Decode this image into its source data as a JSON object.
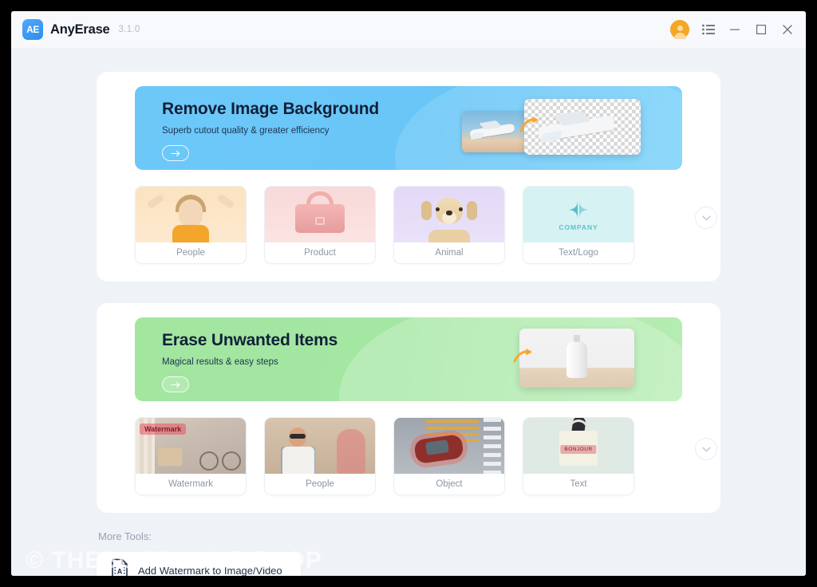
{
  "titlebar": {
    "logo_text": "AE",
    "app_name": "AnyErase",
    "version": "3.1.0",
    "account_icon": "user-avatar-icon",
    "menu_icon": "list-menu-icon",
    "minimize_label": "—",
    "maximize_label": "□",
    "close_label": "✕"
  },
  "sections": [
    {
      "id": "remove-background",
      "hero": {
        "title": "Remove Image Background",
        "subtitle": "Superb cutout quality & greater efficiency",
        "cta_icon": "arrow-right-icon",
        "accent": "#69c6f7"
      },
      "expand_icon": "chevron-down-icon",
      "cards": [
        {
          "label": "People",
          "thumb": "girl-photo"
        },
        {
          "label": "Product",
          "thumb": "pink-handbag-photo"
        },
        {
          "label": "Animal",
          "thumb": "golden-retriever-photo"
        },
        {
          "label": "Text/Logo",
          "thumb": "company-logo-graphic",
          "logo_caption": "COMPANY"
        }
      ]
    },
    {
      "id": "erase-items",
      "hero": {
        "title": "Erase Unwanted Items",
        "subtitle": "Magical results & easy steps",
        "cta_icon": "arrow-right-icon",
        "accent": "#a2e6a0"
      },
      "expand_icon": "chevron-down-icon",
      "cards": [
        {
          "label": "Watermark",
          "thumb": "bicycle-photo",
          "overlay_text": "Watermark"
        },
        {
          "label": "People",
          "thumb": "man-street-photo"
        },
        {
          "label": "Object",
          "thumb": "red-car-photo"
        },
        {
          "label": "Text",
          "thumb": "tote-bag-photo",
          "overlay_text": "BONJOUR"
        }
      ]
    }
  ],
  "more_tools": {
    "label": "More Tools:",
    "buttons": [
      {
        "label": "Add Watermark to Image/Video",
        "icon": "add-watermark-icon"
      }
    ]
  },
  "watermark": {
    "text": "© THESOFTWARE.SHOP"
  },
  "colors": {
    "page_background": "#eff2f7",
    "panel_background": "#ffffff",
    "blue_accent": "#69c6f7",
    "green_accent": "#a2e6a0",
    "brand_blue": "#2b8ef0",
    "avatar_orange": "#f5a623",
    "title_dark": "#122038",
    "label_grey": "#8d96a4"
  }
}
